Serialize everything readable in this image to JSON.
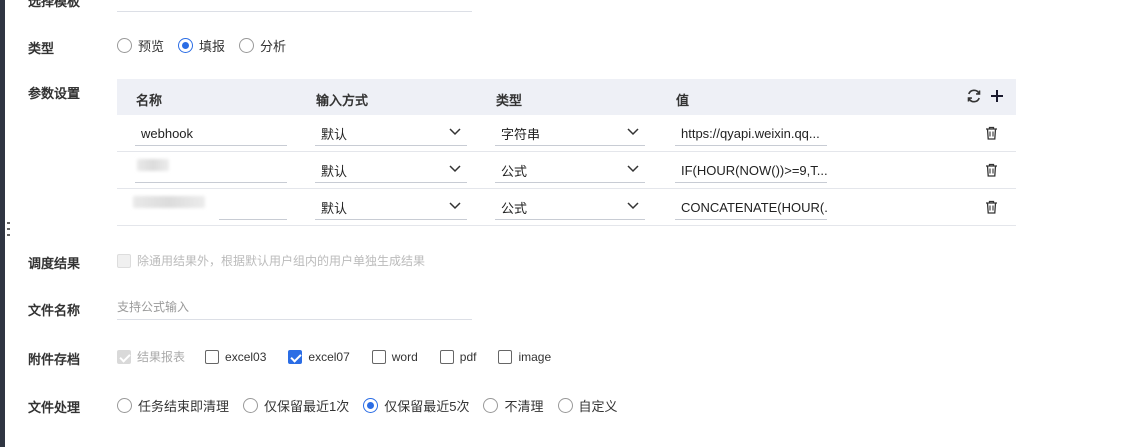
{
  "form": {
    "template_label": "选择模板",
    "type": {
      "label": "类型",
      "options": [
        {
          "label": "预览",
          "checked": false
        },
        {
          "label": "填报",
          "checked": true
        },
        {
          "label": "分析",
          "checked": false
        }
      ]
    },
    "params": {
      "label": "参数设置",
      "headers": {
        "name": "名称",
        "input_mode": "输入方式",
        "type": "类型",
        "value": "值"
      },
      "rows": [
        {
          "name": "webhook",
          "input_mode": "默认",
          "type": "字符串",
          "value": "https://qyapi.weixin.qq..."
        },
        {
          "name": "",
          "input_mode": "默认",
          "type": "公式",
          "value": "IF(HOUR(NOW())>=9,T..."
        },
        {
          "name": "",
          "input_mode": "默认",
          "type": "公式",
          "value": "CONCATENATE(HOUR(..."
        }
      ]
    },
    "schedule_result": {
      "label": "调度结果",
      "option": "除通用结果外，根据默认用户组内的用户单独生成结果"
    },
    "file_name": {
      "label": "文件名称",
      "placeholder": "支持公式输入"
    },
    "attachment": {
      "label": "附件存档",
      "options": [
        {
          "label": "结果报表",
          "checked": true,
          "disabled": true
        },
        {
          "label": "excel03",
          "checked": false
        },
        {
          "label": "excel07",
          "checked": true
        },
        {
          "label": "word",
          "checked": false
        },
        {
          "label": "pdf",
          "checked": false
        },
        {
          "label": "image",
          "checked": false
        }
      ]
    },
    "file_processing": {
      "label": "文件处理",
      "options": [
        {
          "label": "任务结束即清理",
          "checked": false
        },
        {
          "label": "仅保留最近1次",
          "checked": false
        },
        {
          "label": "仅保留最近5次",
          "checked": true
        },
        {
          "label": "不清理",
          "checked": false
        },
        {
          "label": "自定义",
          "checked": false
        }
      ]
    }
  },
  "icons": {
    "refresh": "refresh-icon",
    "add": "plus-icon",
    "delete": "trash-icon",
    "dropdown": "chevron-down-icon"
  },
  "colors": {
    "accent": "#2b6de5",
    "table_header_bg": "#eef0f6"
  }
}
